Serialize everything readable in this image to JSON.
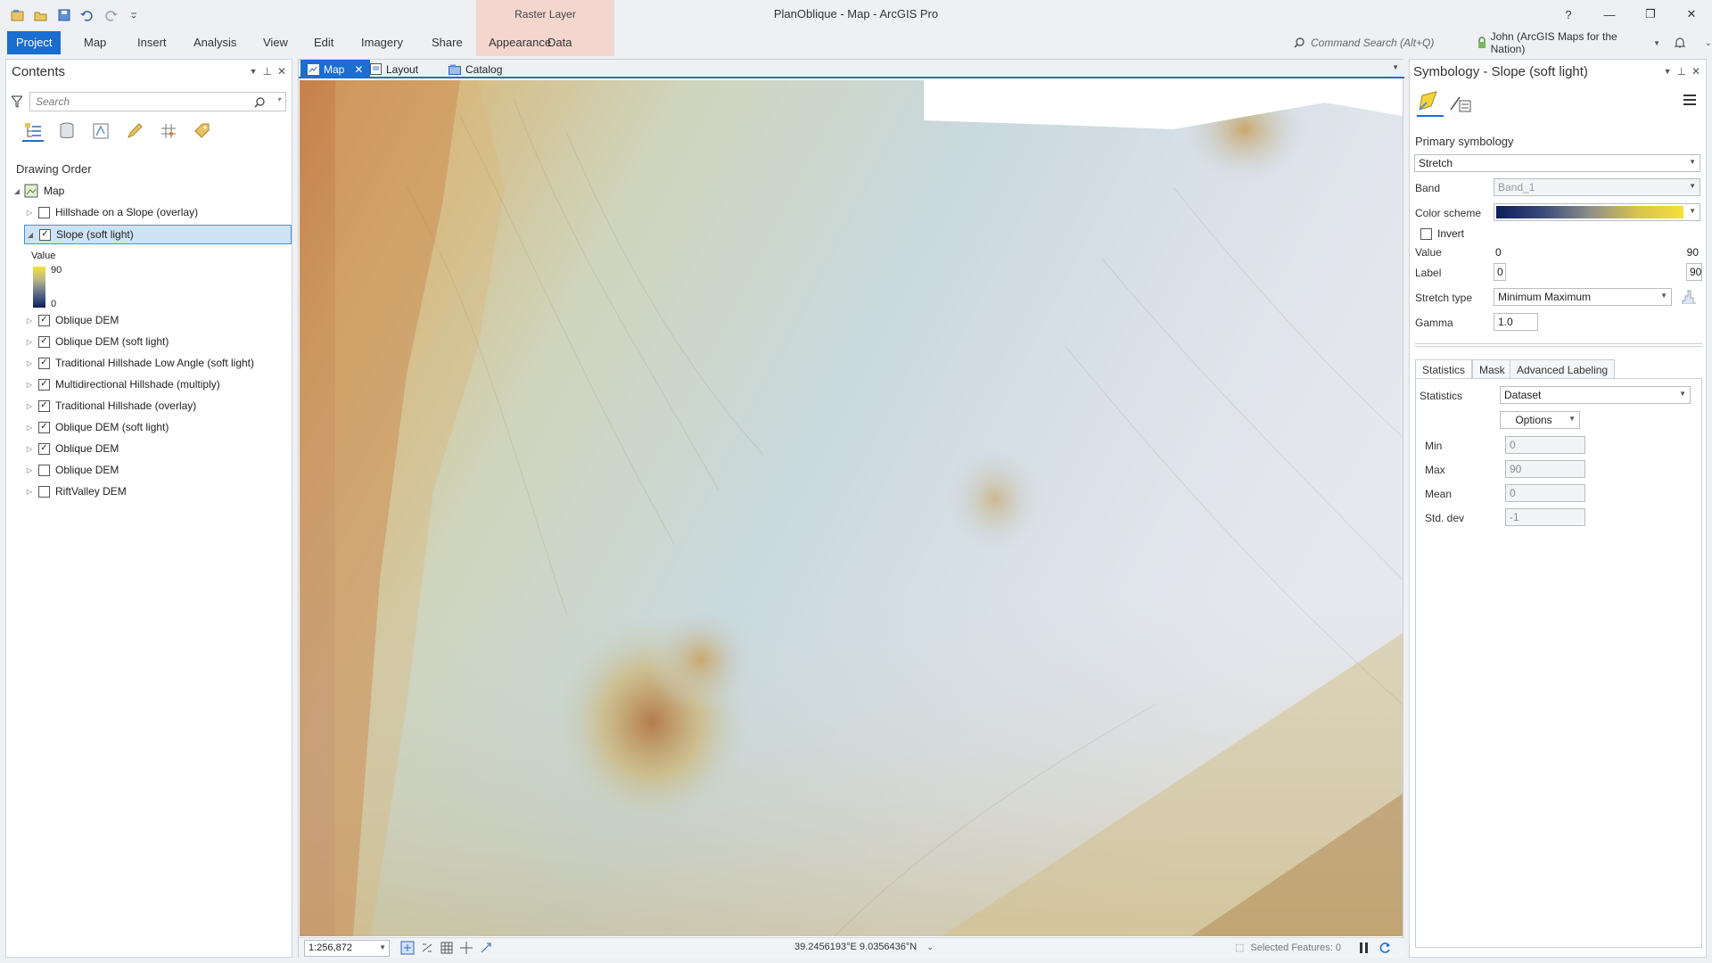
{
  "app": {
    "title": "PlanOblique - Map - ArcGIS Pro",
    "context_group": "Raster Layer"
  },
  "window": {
    "help": "?",
    "minimize": "—",
    "restore": "❐",
    "close": "✕"
  },
  "ribbon": {
    "tabs": [
      "Project",
      "Map",
      "Insert",
      "Analysis",
      "View",
      "Edit",
      "Imagery",
      "Share",
      "Appearance",
      "Data"
    ],
    "command_search_placeholder": "Command Search (Alt+Q)",
    "user": "John (ArcGIS Maps for the Nation)"
  },
  "contents": {
    "title": "Contents",
    "search_placeholder": "Search",
    "drawing_order_label": "Drawing Order",
    "map_label": "Map",
    "layers": [
      {
        "name": "Hillshade on a Slope (overlay)",
        "checked": false,
        "expanded": false,
        "selected": false
      },
      {
        "name": "Slope (soft light)",
        "checked": true,
        "expanded": true,
        "selected": true
      },
      {
        "name": "Oblique DEM",
        "checked": true,
        "expanded": false,
        "selected": false
      },
      {
        "name": "Oblique DEM (soft light)",
        "checked": true,
        "expanded": false,
        "selected": false
      },
      {
        "name": "Traditional Hillshade Low Angle (soft light)",
        "checked": true,
        "expanded": false,
        "selected": false
      },
      {
        "name": "Multidirectional Hillshade (multiply)",
        "checked": true,
        "expanded": false,
        "selected": false
      },
      {
        "name": "Traditional Hillshade (overlay)",
        "checked": true,
        "expanded": false,
        "selected": false
      },
      {
        "name": "Oblique DEM (soft light)",
        "checked": true,
        "expanded": false,
        "selected": false
      },
      {
        "name": "Oblique DEM",
        "checked": true,
        "expanded": false,
        "selected": false
      },
      {
        "name": "Oblique DEM",
        "checked": false,
        "expanded": false,
        "selected": false
      },
      {
        "name": "RiftValley DEM",
        "checked": false,
        "expanded": false,
        "selected": false
      }
    ],
    "legend": {
      "title": "Value",
      "max": "90",
      "min": "0"
    }
  },
  "map_tabs": [
    {
      "label": "Map",
      "active": true
    },
    {
      "label": "Layout",
      "active": false
    },
    {
      "label": "Catalog",
      "active": false
    }
  ],
  "map_status": {
    "scale": "1:256,872",
    "coordinates": "39.2456193°E 9.0356436°N",
    "selected_features": "Selected Features: 0"
  },
  "symbology": {
    "title": "Symbology - Slope (soft light)",
    "primary_label": "Primary symbology",
    "renderer": "Stretch",
    "band_label": "Band",
    "band_value": "Band_1",
    "color_scheme_label": "Color scheme",
    "invert_label": "Invert",
    "value_label": "Value",
    "value_min": "0",
    "value_max": "90",
    "label_label": "Label",
    "label_min": "0",
    "label_max": "90",
    "stretch_type_label": "Stretch type",
    "stretch_type": "Minimum Maximum",
    "gamma_label": "Gamma",
    "gamma": "1.0",
    "tabs": [
      "Statistics",
      "Mask",
      "Advanced Labeling"
    ],
    "statistics_label": "Statistics",
    "statistics_value": "Dataset",
    "options_label": "Options",
    "stats": [
      {
        "label": "Min",
        "value": "0"
      },
      {
        "label": "Max",
        "value": "90"
      },
      {
        "label": "Mean",
        "value": "0"
      },
      {
        "label": "Std. dev",
        "value": "-1"
      }
    ]
  },
  "colors": {
    "accent": "#1a6dd1",
    "context_tab": "#f3d7cf",
    "ramp_low": "#0b1f5c",
    "ramp_high": "#f5e03a"
  }
}
